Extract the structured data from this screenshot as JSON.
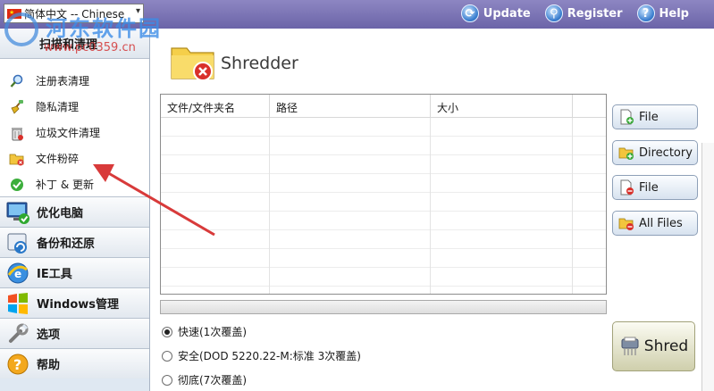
{
  "header": {
    "language_selected": "简体中文 -- Chinese",
    "update_label": "Update",
    "register_label": "Register",
    "help_label": "Help"
  },
  "watermark": {
    "title": "河东软件园",
    "url": "www.pc0359.cn"
  },
  "sidebar": {
    "active_section_label": "扫描和清理",
    "sub_items": [
      {
        "label": "注册表清理",
        "icon": "magnifier-icon"
      },
      {
        "label": "隐私清理",
        "icon": "broom-icon"
      },
      {
        "label": "垃圾文件清理",
        "icon": "trash-icon"
      },
      {
        "label": "文件粉碎",
        "icon": "shredder-folder-icon"
      },
      {
        "label": "补丁 & 更新",
        "icon": "patch-update-icon"
      }
    ],
    "sections": [
      {
        "label": "优化电脑",
        "icon": "monitor-icon"
      },
      {
        "label": "备份和还原",
        "icon": "backup-icon"
      },
      {
        "label": "IE工具",
        "icon": "ie-icon"
      },
      {
        "label": "Windows管理",
        "icon": "windows-icon"
      },
      {
        "label": "选项",
        "icon": "wrench-icon"
      },
      {
        "label": "帮助",
        "icon": "help-icon"
      }
    ]
  },
  "main": {
    "title": "Shredder",
    "table": {
      "columns": [
        "文件/文件夹名",
        "路径",
        "大小"
      ]
    },
    "buttons": {
      "add_file": "File",
      "add_directory": "Directory",
      "remove_file": "File",
      "remove_all": "All Files",
      "shred": "Shred"
    },
    "options": [
      {
        "label": "快速(1次覆盖)",
        "selected": true
      },
      {
        "label": "安全(DOD 5220.22-M:标准 3次覆盖)",
        "selected": false
      },
      {
        "label": "彻底(7次覆盖)",
        "selected": false
      }
    ]
  },
  "colors": {
    "title_bar": "#6b64a8",
    "sidebar_bg": "#dfe8f2",
    "annotation_arrow": "#d83a3a"
  }
}
